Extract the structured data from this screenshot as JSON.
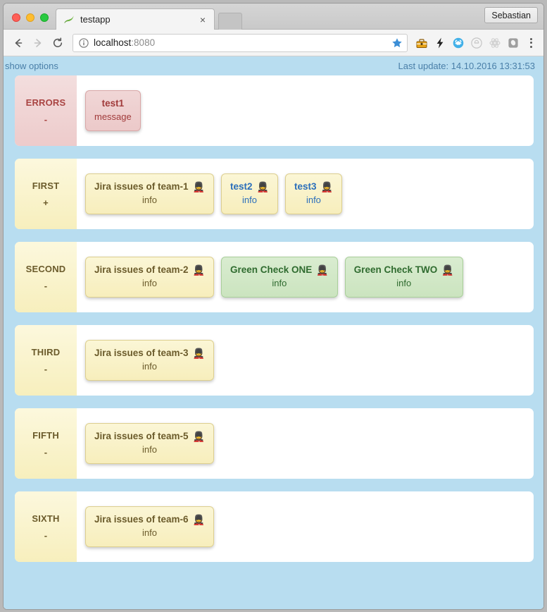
{
  "window": {
    "traffic_lights": [
      "close",
      "minimize",
      "maximize"
    ],
    "profile_label": "Sebastian"
  },
  "tab": {
    "title": "testapp",
    "favicon": "leaf-icon",
    "close_label": "×"
  },
  "toolbar": {
    "back_icon": "arrow-left-icon",
    "forward_icon": "arrow-right-icon",
    "reload_icon": "reload-icon",
    "site_info_icon": "info-circle-icon",
    "url_host": "localhost",
    "url_port": ":8080",
    "url_full": "localhost:8080",
    "bookmark_icon": "star-icon",
    "extensions": [
      "toolbox-icon",
      "lightning-bolt-icon",
      "command-circle-icon",
      "gray-circle-icon",
      "atom-icon",
      "shield-square-icon"
    ],
    "menu_icon": "three-dots-menu-icon"
  },
  "page": {
    "options_link": "show options",
    "last_update": "Last update: 14.10.2016 13:31:53",
    "colors": {
      "background": "#b8ddf0",
      "row_background": "#ffffff",
      "label_yellow": "#f7efbd",
      "label_red": "#edcbcb",
      "card_yellow": "#f7eebc",
      "card_green": "#cbe4bf",
      "card_red": "#ecc9c9",
      "link_blue": "#2a6ebb",
      "text_yellow": "#6b5b2b",
      "text_green": "#2f6b2f",
      "text_red": "#a13b3b"
    },
    "groups": [
      {
        "name": "ERRORS",
        "toggle": "-",
        "tone": "red",
        "cards": [
          {
            "title": "test1",
            "sub": "message",
            "tone": "red",
            "avatar": "",
            "link": false,
            "wide": false
          }
        ]
      },
      {
        "name": "FIRST",
        "toggle": "+",
        "tone": "yellow",
        "cards": [
          {
            "title": "Jira issues of team-1",
            "sub": "info",
            "tone": "yellow",
            "avatar": "💂",
            "link": false,
            "wide": true
          },
          {
            "title": "test2",
            "sub": "info",
            "tone": "yellow",
            "avatar": "💂",
            "link": true,
            "wide": false
          },
          {
            "title": "test3",
            "sub": "info",
            "tone": "yellow",
            "avatar": "💂",
            "link": true,
            "wide": false
          }
        ]
      },
      {
        "name": "SECOND",
        "toggle": "-",
        "tone": "yellow",
        "cards": [
          {
            "title": "Jira issues of team-2",
            "sub": "info",
            "tone": "yellow",
            "avatar": "💂",
            "link": false,
            "wide": true
          },
          {
            "title": "Green Check ONE",
            "sub": "info",
            "tone": "green",
            "avatar": "💂",
            "link": false,
            "wide": true
          },
          {
            "title": "Green Check TWO",
            "sub": "info",
            "tone": "green",
            "avatar": "💂",
            "link": false,
            "wide": true
          }
        ]
      },
      {
        "name": "THIRD",
        "toggle": "-",
        "tone": "yellow",
        "cards": [
          {
            "title": "Jira issues of team-3",
            "sub": "info",
            "tone": "yellow",
            "avatar": "💂",
            "link": false,
            "wide": true
          }
        ]
      },
      {
        "name": "FIFTH",
        "toggle": "-",
        "tone": "yellow",
        "cards": [
          {
            "title": "Jira issues of team-5",
            "sub": "info",
            "tone": "yellow",
            "avatar": "💂",
            "link": false,
            "wide": true
          }
        ]
      },
      {
        "name": "SIXTH",
        "toggle": "-",
        "tone": "yellow",
        "cards": [
          {
            "title": "Jira issues of team-6",
            "sub": "info",
            "tone": "yellow",
            "avatar": "💂",
            "link": false,
            "wide": true
          }
        ]
      }
    ]
  }
}
